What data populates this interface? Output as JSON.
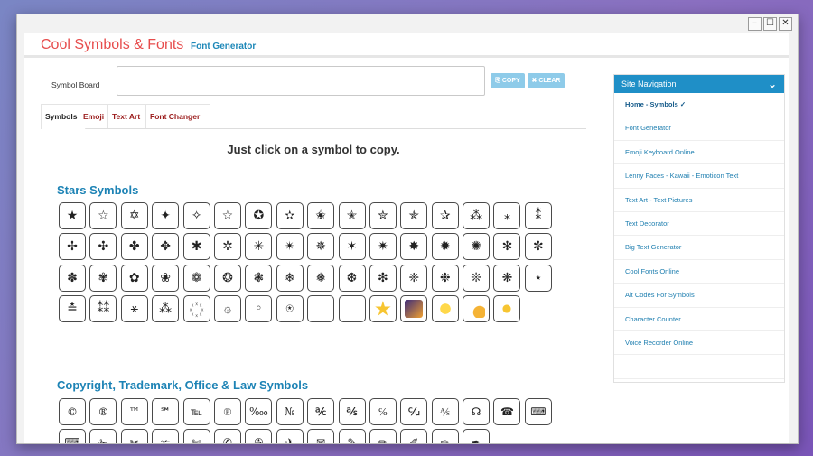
{
  "window": {
    "controls": [
      "–",
      "☐",
      "✕"
    ]
  },
  "header": {
    "logo": "Cool Symbols & Fonts",
    "subtitle": "Font Generator"
  },
  "board": {
    "label": "Symbol Board",
    "copy_label": "COPY",
    "clear_label": "CLEAR"
  },
  "tabs": [
    {
      "label": "Symbols",
      "active": true
    },
    {
      "label": "Emoji"
    },
    {
      "label": "Text Art"
    },
    {
      "label": "Font Changer"
    }
  ],
  "instruction": "Just click on a symbol to copy.",
  "sections": [
    {
      "title": "Stars Symbols",
      "symbols": [
        "★",
        "☆",
        "✡",
        "✦",
        "✧",
        "☆",
        "✪",
        "✫",
        "✬",
        "✭",
        "✮",
        "✯",
        "✰",
        "⁂",
        "⁎",
        "⁑",
        "✢",
        "✣",
        "✤",
        "✥",
        "✱",
        "✲",
        "✳",
        "✴",
        "✵",
        "✶",
        "✷",
        "✸",
        "✹",
        "✺",
        "✻",
        "✼",
        "✽",
        "✾",
        "✿",
        "❀",
        "❁",
        "❂",
        "❃",
        "❄",
        "❅",
        "❆",
        "❇",
        "❈",
        "❉",
        "❊",
        "❋",
        "⋆",
        "≛",
        "⁑⁑",
        "⚹",
        "⁂",
        "꙰",
        "۞",
        "◦",
        "⍟",
        "",
        "",
        "",
        "",
        "",
        "",
        ""
      ],
      "emoji": {
        "58": "star",
        "59": "night",
        "60": "sun",
        "61": "shoot",
        "62": "sparkle",
        "63": "milky",
        "64": "six"
      }
    },
    {
      "title": "Copyright, Trademark, Office & Law Symbols",
      "symbols": [
        "©",
        "®",
        "™",
        "℠",
        "℡",
        "℗",
        "‱",
        "№",
        "℀",
        "℁",
        "℅",
        "℆",
        "⅍",
        "☊",
        "☎",
        "⌨",
        "⌨",
        "✁",
        "✂",
        "✃",
        "✄",
        "✆",
        "✇",
        "✈",
        "✉",
        "✎",
        "✏",
        "✐",
        "✑",
        "✒"
      ]
    }
  ],
  "sidebar": {
    "title": "Site Navigation",
    "items": [
      "Home - Symbols ✓",
      "Font Generator",
      "Emoji Keyboard Online",
      "Lenny Faces - Kawaii - Emoticon Text",
      "Text Art - Text Pictures",
      "Text Decorator",
      "Big Text Generator",
      "Cool Fonts Online",
      "Alt Codes For Symbols",
      "Character Counter",
      "Voice Recorder Online",
      ""
    ]
  },
  "colors": {
    "accent": "#1f8fc7",
    "logo": "#e74c4c",
    "tab_text": "#9b1c1c"
  }
}
